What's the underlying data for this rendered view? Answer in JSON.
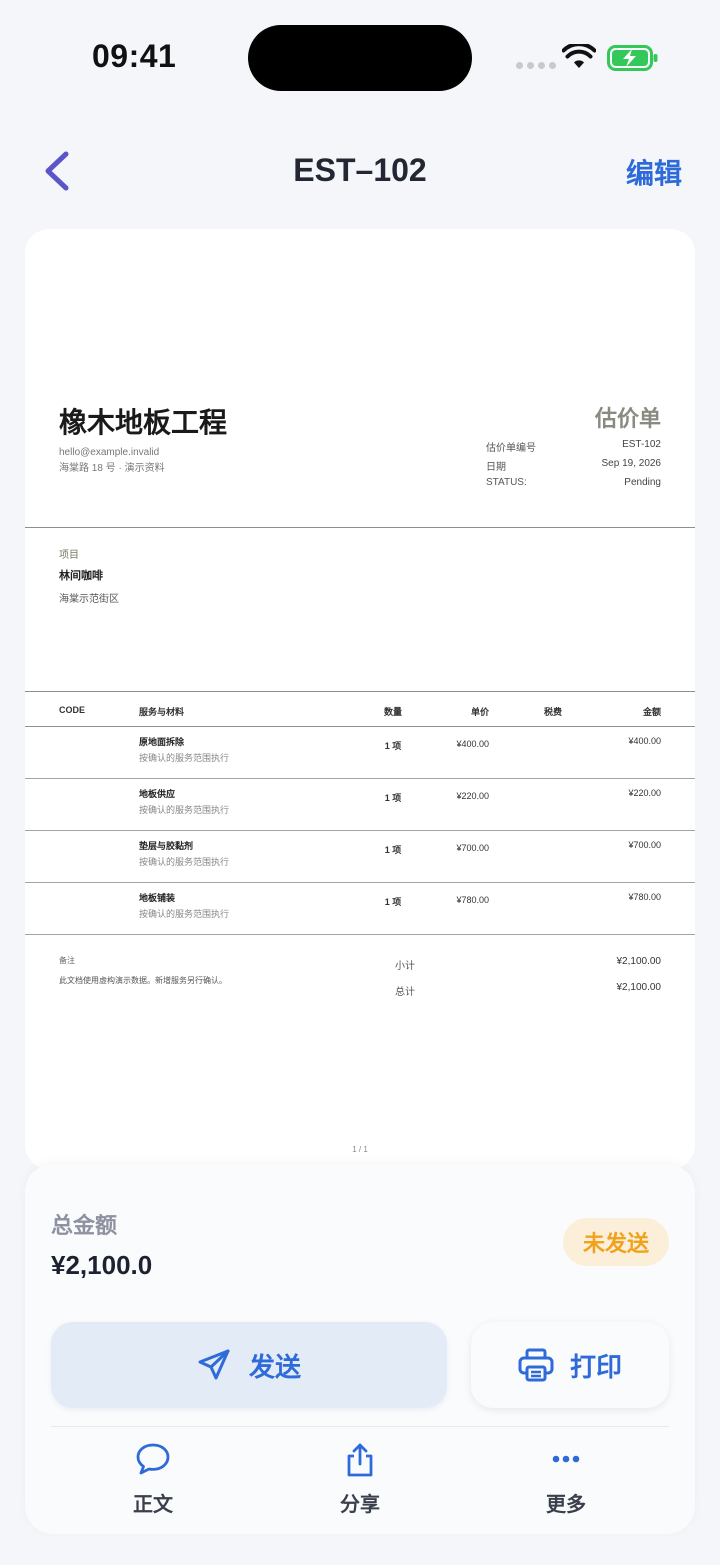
{
  "status_bar": {
    "time": "09:41"
  },
  "nav": {
    "title": "EST–102",
    "edit_label": "编辑"
  },
  "document": {
    "company": "橡木地板工程",
    "email": "hello@example.invalid",
    "address": "海棠路 18 号 · 演示资料",
    "doc_type": "估价单",
    "meta": [
      {
        "key": "估价单编号",
        "value": "EST-102"
      },
      {
        "key": "日期",
        "value": "Sep 19, 2026"
      },
      {
        "key": "STATUS:",
        "value": "Pending"
      }
    ],
    "client_label": "项目",
    "client_name": "林间咖啡",
    "client_address": "海棠示范街区",
    "table_headers": {
      "code": "CODE",
      "item": "服务与材料",
      "qty": "数量",
      "price": "单价",
      "tax": "税费",
      "amount": "金额"
    },
    "items": [
      {
        "name": "原地面拆除",
        "desc": "按确认的服务范围执行",
        "qty": "1 项",
        "price": "¥400.00",
        "amount": "¥400.00"
      },
      {
        "name": "地板供应",
        "desc": "按确认的服务范围执行",
        "qty": "1 项",
        "price": "¥220.00",
        "amount": "¥220.00"
      },
      {
        "name": "垫层与胶黏剂",
        "desc": "按确认的服务范围执行",
        "qty": "1 项",
        "price": "¥700.00",
        "amount": "¥700.00"
      },
      {
        "name": "地板铺装",
        "desc": "按确认的服务范围执行",
        "qty": "1 项",
        "price": "¥780.00",
        "amount": "¥780.00"
      }
    ],
    "notes_label": "备注",
    "notes_text": "此文档使用虚构演示数据。新增服务另行确认。",
    "subtotal_label": "小计",
    "subtotal_value": "¥2,100.00",
    "total_label": "总计",
    "total_value": "¥2,100.00",
    "page": "1 / 1"
  },
  "summary": {
    "total_label": "总金额",
    "total_value": "¥2,100.0",
    "status_badge": "未发送",
    "status_color": "#f0a21c"
  },
  "actions": {
    "send_label": "发送",
    "print_label": "打印"
  },
  "tabs": [
    {
      "label": "正文",
      "icon": "chat-bubble-icon"
    },
    {
      "label": "分享",
      "icon": "share-icon"
    },
    {
      "label": "更多",
      "icon": "more-icon"
    }
  ],
  "colors": {
    "accent": "#2f6bd8",
    "back_arrow": "#5b55c9",
    "battery": "#34c759"
  }
}
